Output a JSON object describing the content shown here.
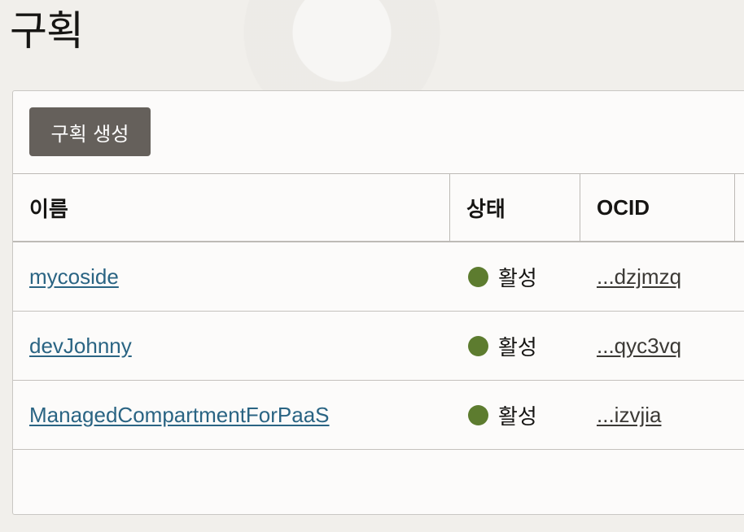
{
  "page": {
    "title": "구획"
  },
  "toolbar": {
    "create_label": "구획 생성"
  },
  "table": {
    "columns": [
      "이름",
      "상태",
      "OCID"
    ],
    "rows": [
      {
        "name": "mycoside",
        "status": "활성",
        "ocid": "...dzjmzq"
      },
      {
        "name": "devJohnny",
        "status": "활성",
        "ocid": "...qyc3vq"
      },
      {
        "name": "ManagedCompartmentForPaaS",
        "status": "활성",
        "ocid": "...izvjia"
      }
    ]
  },
  "colors": {
    "button_bg": "#65605b",
    "link": "#2a6483",
    "status_active": "#5d7c2f"
  }
}
